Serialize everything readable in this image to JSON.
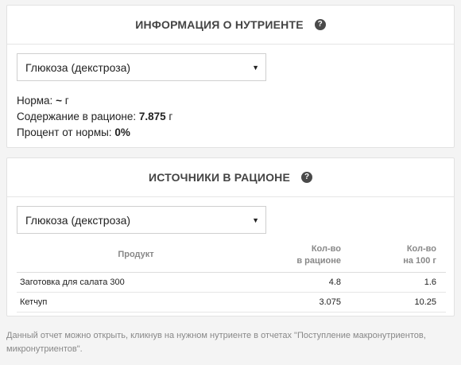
{
  "nutrient_info": {
    "title": "Информация о нутриенте",
    "help_icon": "question-circle-icon",
    "selected": "Глюкоза (декстроза)",
    "norm_label": "Норма:",
    "norm_value": "~",
    "norm_unit": "г",
    "content_label": "Содержание в рационе:",
    "content_value": "7.875",
    "content_unit": "г",
    "percent_label": "Процент от нормы:",
    "percent_value": "0%"
  },
  "sources": {
    "title": "Источники в рационе",
    "help_icon": "question-circle-icon",
    "selected": "Глюкоза (декстроза)",
    "columns": {
      "product": "Продукт",
      "amount_line1": "Кол-во",
      "amount_line2": "в рационе",
      "per100_line1": "Кол-во",
      "per100_line2": "на 100 г"
    },
    "rows": [
      {
        "product": "Заготовка для салата 300",
        "amount": "4.8",
        "per100": "1.6"
      },
      {
        "product": "Кетчуп",
        "amount": "3.075",
        "per100": "10.25"
      }
    ]
  },
  "footnote": "Данный отчет можно открыть, кликнув на нужном нутриенте в отчетах \"Поступление макронутриентов, микронутриентов\"."
}
